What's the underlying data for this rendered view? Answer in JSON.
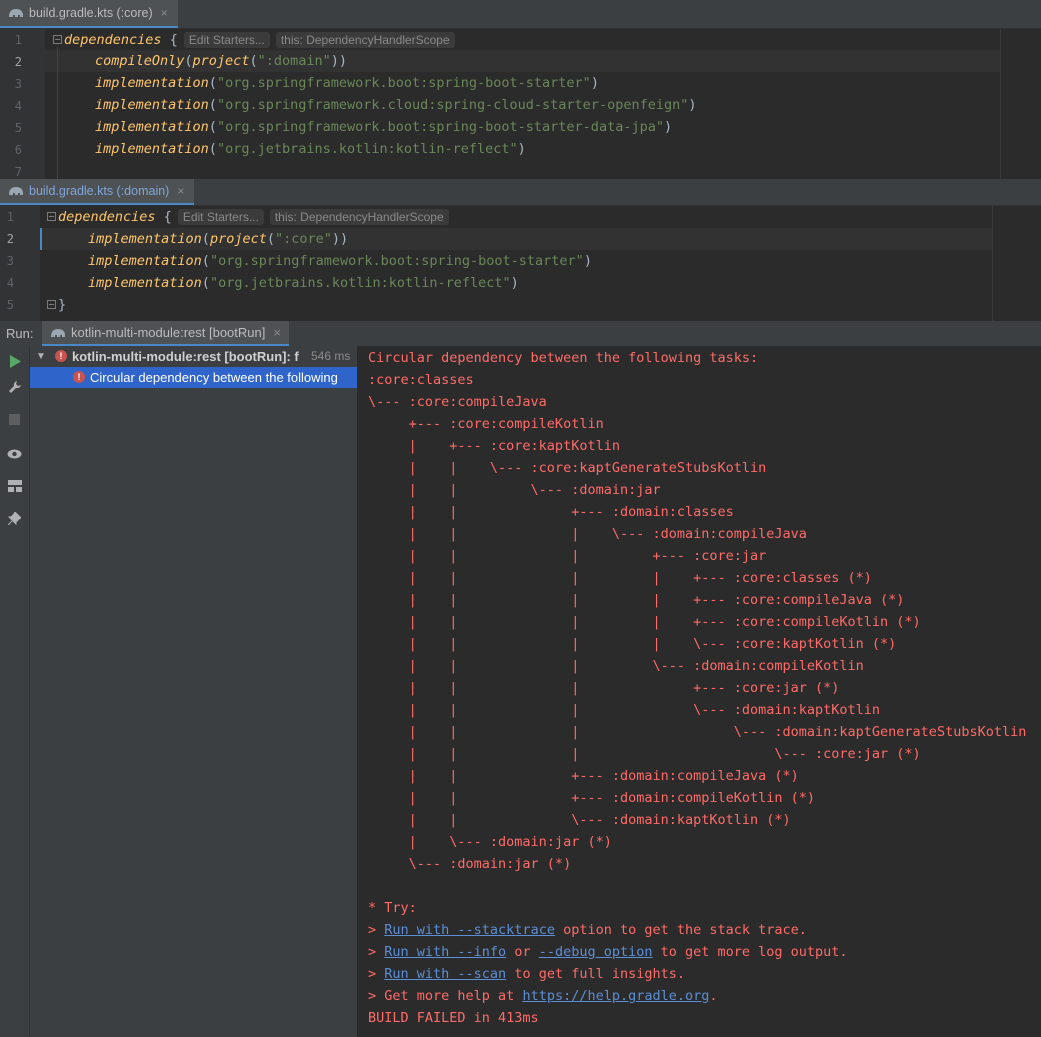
{
  "editor1": {
    "tab": {
      "label": "build.gradle.kts (:core)",
      "close": "×"
    },
    "line_numbers": [
      "1",
      "2",
      "3",
      "4",
      "5",
      "6",
      "7"
    ],
    "lines": [
      {
        "kw": "dependencies",
        "rest": " {",
        "hint1": "Edit Starters...",
        "hint2": "this: DependencyHandlerScope"
      },
      {
        "kw": "compileOnly",
        "p1": "(",
        "kw2": "project",
        "p2": "(",
        "str": "\":domain\"",
        "end": "))"
      },
      {
        "kw": "implementation",
        "p1": "(",
        "str": "\"org.springframework.boot:spring-boot-starter\"",
        "end": ")"
      },
      {
        "kw": "implementation",
        "p1": "(",
        "str": "\"org.springframework.cloud:spring-cloud-starter-openfeign\"",
        "end": ")"
      },
      {
        "kw": "implementation",
        "p1": "(",
        "str": "\"org.springframework.boot:spring-boot-starter-data-jpa\"",
        "end": ")"
      },
      {
        "kw": "implementation",
        "p1": "(",
        "str": "\"org.jetbrains.kotlin:kotlin-reflect\"",
        "end": ")"
      }
    ]
  },
  "editor2": {
    "tab": {
      "label": "build.gradle.kts (:domain)",
      "close": "×"
    },
    "line_numbers": [
      "1",
      "2",
      "3",
      "4",
      "5"
    ],
    "lines": [
      {
        "kw": "dependencies",
        "rest": " {",
        "hint1": "Edit Starters...",
        "hint2": "this: DependencyHandlerScope"
      },
      {
        "kw": "implementation",
        "p1": "(",
        "kw2": "project",
        "p2": "(",
        "str": "\":core\"",
        "end": "))"
      },
      {
        "kw": "implementation",
        "p1": "(",
        "str": "\"org.springframework.boot:spring-boot-starter\"",
        "end": ")"
      },
      {
        "kw": "implementation",
        "p1": "(",
        "str": "\"org.jetbrains.kotlin:kotlin-reflect\"",
        "end": ")"
      },
      {
        "rest": "}"
      }
    ]
  },
  "run": {
    "label": "Run:",
    "tab_label": "kotlin-multi-module:rest [bootRun]",
    "tab_close": "×",
    "tree": {
      "root": "kotlin-multi-module:rest [bootRun]: f",
      "root_time": "546 ms",
      "child": "Circular dependency between the following"
    },
    "console": {
      "lines": [
        "Circular dependency between the following tasks:",
        ":core:classes",
        "\\--- :core:compileJava",
        "     +--- :core:compileKotlin",
        "     |    +--- :core:kaptKotlin",
        "     |    |    \\--- :core:kaptGenerateStubsKotlin",
        "     |    |         \\--- :domain:jar",
        "     |    |              +--- :domain:classes",
        "     |    |              |    \\--- :domain:compileJava",
        "     |    |              |         +--- :core:jar",
        "     |    |              |         |    +--- :core:classes (*)",
        "     |    |              |         |    +--- :core:compileJava (*)",
        "     |    |              |         |    +--- :core:compileKotlin (*)",
        "     |    |              |         |    \\--- :core:kaptKotlin (*)",
        "     |    |              |         \\--- :domain:compileKotlin",
        "     |    |              |              +--- :core:jar (*)",
        "     |    |              |              \\--- :domain:kaptKotlin",
        "     |    |              |                   \\--- :domain:kaptGenerateStubsKotlin",
        "     |    |              |                        \\--- :core:jar (*)",
        "     |    |              +--- :domain:compileJava (*)",
        "     |    |              +--- :domain:compileKotlin (*)",
        "     |    |              \\--- :domain:kaptKotlin (*)",
        "     |    \\--- :domain:jar (*)",
        "     \\--- :domain:jar (*)"
      ],
      "try_heading": "* Try:",
      "try1": {
        "prefix": "> ",
        "link": "Run with --stacktrace",
        "suffix": " option to get the stack trace."
      },
      "try2": {
        "prefix": "> ",
        "link": "Run with --info",
        "mid": " or ",
        "link2": "--debug option",
        "suffix": " to get more log output."
      },
      "try3": {
        "prefix": "> ",
        "link": "Run with --scan",
        "suffix": " to get full insights."
      },
      "try4": {
        "prefix": "> Get more help at ",
        "link": "https://help.gradle.org",
        "suffix": "."
      },
      "result": "BUILD FAILED in 413ms"
    }
  },
  "colors": {
    "error": "#ff6b68",
    "keyword": "#ffc66d",
    "string": "#6a8759",
    "selection": "#2f65ca"
  }
}
